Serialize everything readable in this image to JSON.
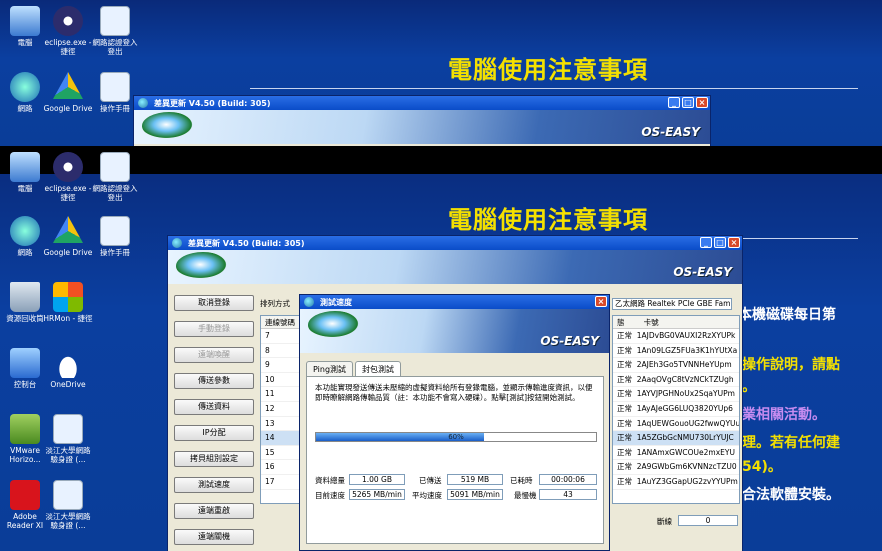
{
  "slide": {
    "title": "電腦使用注意事項",
    "lines": [
      "本機磁碟每日第",
      "操作說明，請點",
      "。",
      "業相關活動。",
      "理。若有任何建",
      "54)。",
      "合法軟體安裝。"
    ]
  },
  "desktop_icons": {
    "computer": "電腦",
    "eclipse": "eclipse.exe - 捷徑",
    "netlogin": "網路認證登入登出",
    "network": "網路",
    "gdrive": "Google Drive",
    "manual": "操作手冊",
    "recycle": "資源回收筒",
    "hrmon": "HRMon - 捷徑",
    "control": "控制台",
    "onedrive": "OneDrive",
    "vmware": "VMware Horizo...",
    "sdu": "淡江大學網路驗身證 (...",
    "acrobat": "Adobe Reader XI",
    "sdu2": "淡江大學網路驗身證 (..."
  },
  "main_window": {
    "title": "差異更新 V4.50 (Build: 305)",
    "brand": "OS-EASY",
    "sort_label": "排列方式",
    "list_header": "連線號碼",
    "network_adapter": "乙太網路 Realtek PCIe GBE Family Con",
    "side_buttons": [
      "取消登錄",
      "手動登錄",
      "遠端喚醒",
      "傳送參數",
      "傳送資料",
      "IP分配",
      "拷貝組別設定",
      "測試速度",
      "遠端重啟",
      "遠端關機"
    ],
    "rows": [
      "7",
      "8",
      "9",
      "10",
      "11",
      "12",
      "13",
      "14",
      "15",
      "16",
      "17"
    ],
    "status_header": "態",
    "card_header": "卡號",
    "status_values": [
      "正常",
      "正常",
      "正常",
      "正常",
      "正常",
      "正常",
      "正常",
      "正常",
      "正常",
      "正常",
      "正常"
    ],
    "card_values": [
      "1AJDvBG0VAUXI2RzXYUPk",
      "1An09LGZ5FUa3K1hYUtXa",
      "2AJEh3Go5TVNNHeYUpm",
      "2AaqOVgC8tVzNCkTZUgh",
      "1AYVJPGHNoUx2SqaYUPm",
      "1AyAJeGG6LUQ3820YUp6",
      "1AqUEWGouoUG2fwwQYUu",
      "1A5ZGbGcNMU730LrYUJC",
      "1ANAmxGWCOUe2mxEYU",
      "2A9GWbGm6KVNNzcTZU0",
      "1AuYZ3GGapUG2zvYYUPm"
    ],
    "footer_label": "斷線",
    "footer_value": "0"
  },
  "dialog": {
    "title": "測試速度",
    "brand": "OS-EASY",
    "tabs": [
      "Ping測試",
      "封包測試"
    ],
    "description": "本功能實現發送傳送未壓縮的虛擬資料給所有登錄電腦，並顯示傳輸進度資訊，以便即時瞭解網路傳輸品質（註：本功能不會寫入硬碟）。點擊[測試]按鈕開始測試。",
    "progress_percent": 60,
    "progress_text": "60%",
    "stats": {
      "total_label": "資料總量",
      "total_value": "1.00 GB",
      "sent_label": "已傳送",
      "sent_value": "519 MB",
      "elapsed_label": "已耗時",
      "elapsed_value": "00:00:06",
      "speed_label": "目前速度",
      "speed_value": "5265 MB/min",
      "avg_label": "平均速度",
      "avg_value": "5091 MB/min",
      "slowest_label": "最慢機",
      "slowest_value": "43"
    }
  },
  "colors": {
    "title_yellow": "#f4e000",
    "desktop_blue": "#0b3fa0"
  }
}
